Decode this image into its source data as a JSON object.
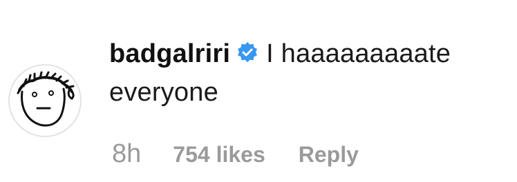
{
  "comment": {
    "avatar_icon": "doodle-face-icon",
    "username": "badgalriri",
    "verified_icon": "verified-badge-icon",
    "text": "I haaaaaaaaate everyone",
    "text_line1": "I haaaaaaaaate",
    "text_line2": "everyone",
    "time": "8h",
    "likes": "754 likes",
    "reply": "Reply",
    "colors": {
      "verified_badge": "#3897f0",
      "meta_text": "#9a9a9a",
      "avatar_border": "#e3e3e3"
    }
  }
}
